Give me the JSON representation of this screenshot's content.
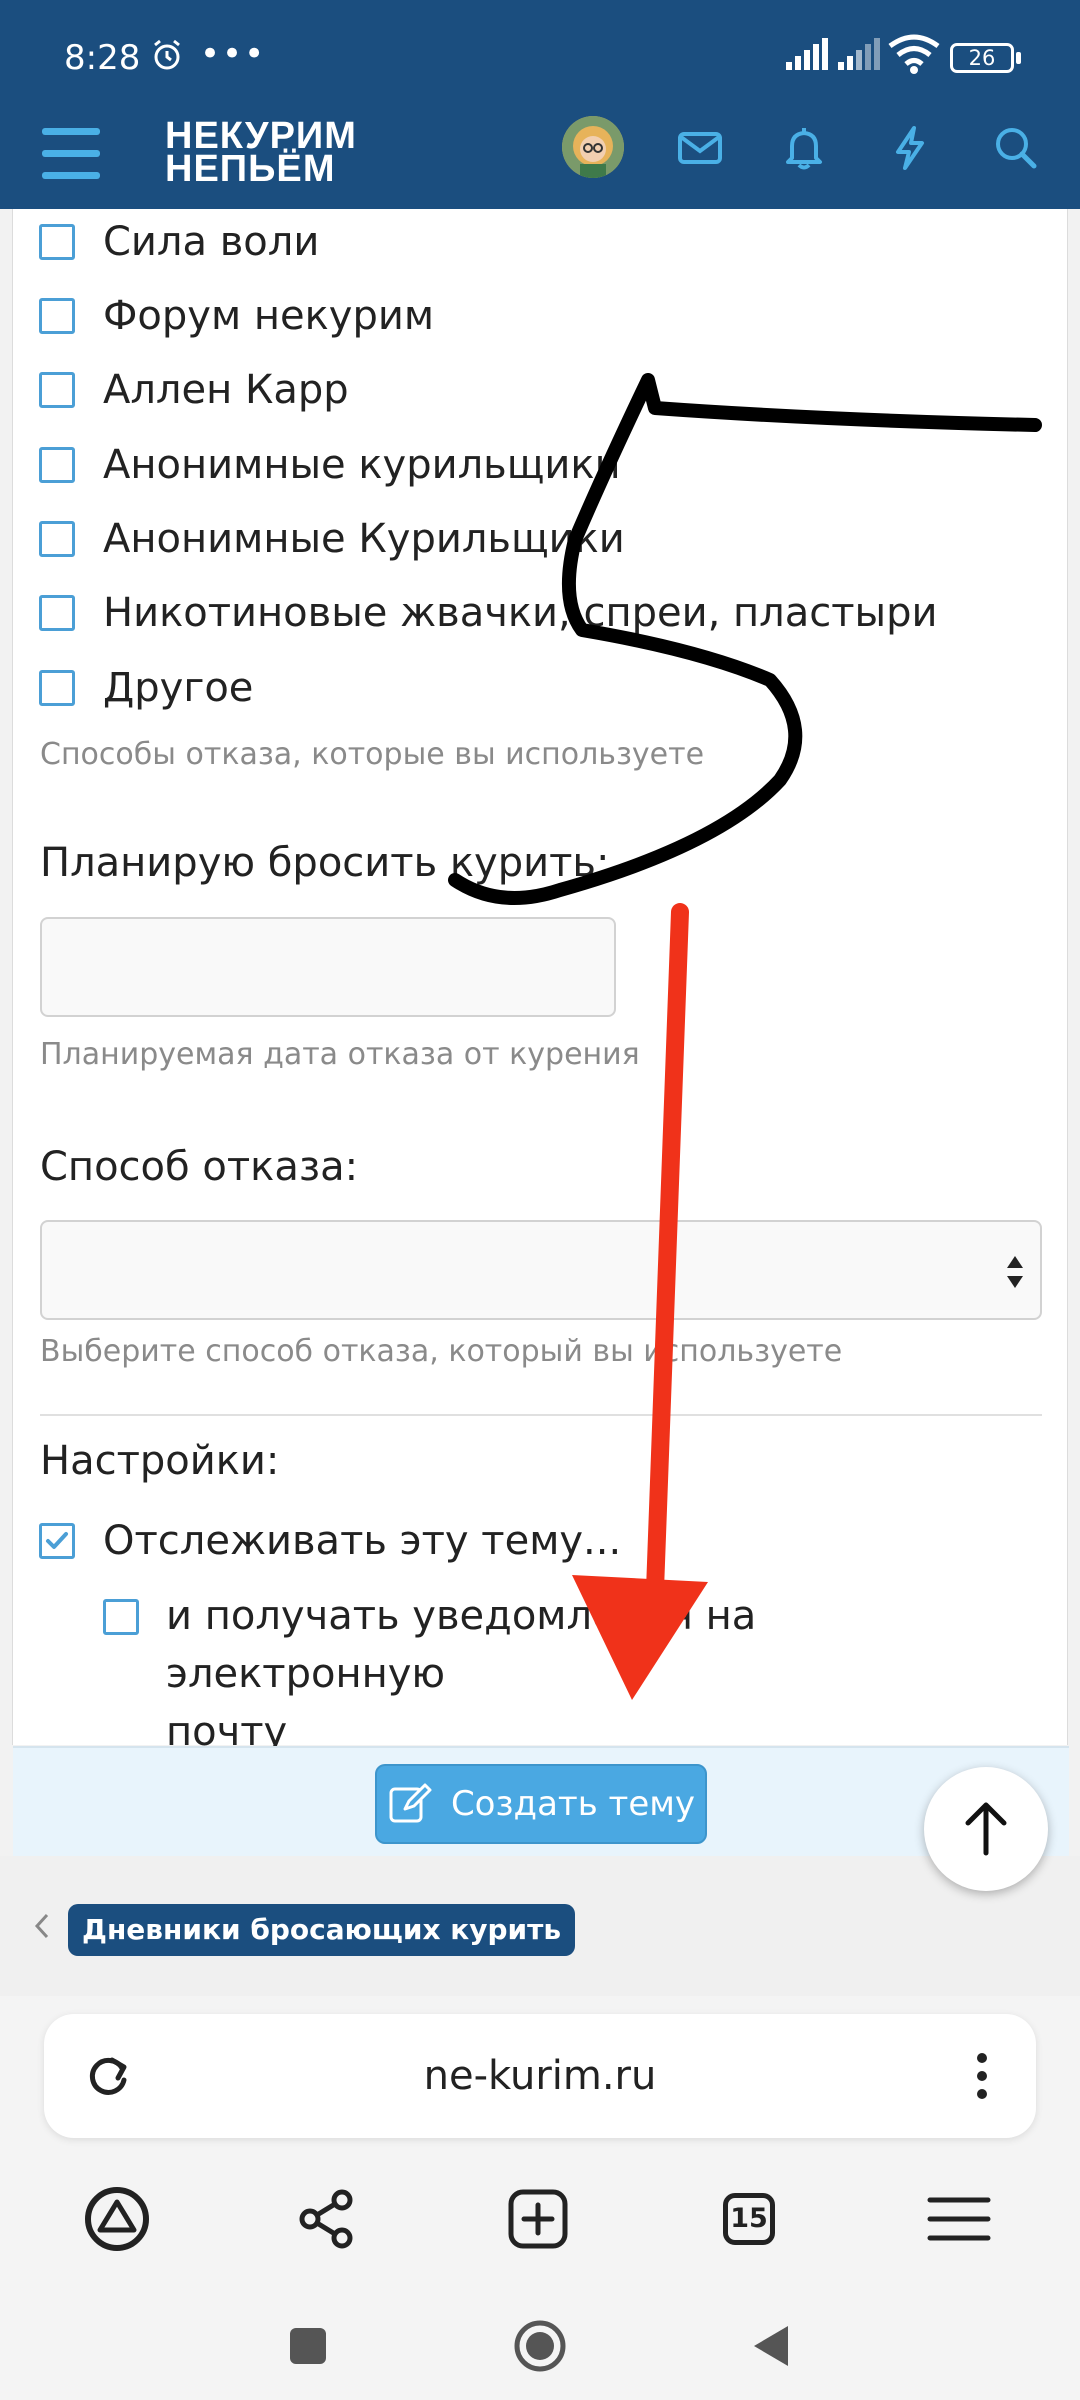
{
  "status": {
    "time": "8:28",
    "dots": "•••",
    "battery": "26"
  },
  "header": {
    "logo_line1": "НЕКУРИМ",
    "logo_line2": "НЕПЬЁМ"
  },
  "form": {
    "checkboxes": [
      {
        "label": "Сила воли",
        "checked": false
      },
      {
        "label": "Форум некурим",
        "checked": false
      },
      {
        "label": "Аллен Карр",
        "checked": false
      },
      {
        "label": "Анонимные курильщики",
        "checked": false
      },
      {
        "label": "Анонимные Курильщики",
        "checked": false
      },
      {
        "label": "Никотиновые жвачки, спреи, пластыри",
        "checked": false
      },
      {
        "label": "Другое",
        "checked": false
      }
    ],
    "methods_hint": "Способы отказа, которые вы используете",
    "plan_label": "Планирую бросить курить:",
    "plan_value": "",
    "plan_hint": "Планируемая дата отказа от курения",
    "method_label": "Способ отказа:",
    "method_value": "",
    "method_hint": "Выберите способ отказа, который вы используете",
    "settings_label": "Настройки:",
    "watch_label": "Отслеживать эту тему...",
    "watch_checked": true,
    "email_label_line1": "и получать уведомления на электронную",
    "email_label_line2": "почту",
    "email_checked": false,
    "submit_label": "Создать тему"
  },
  "breadcrumb": {
    "label": "Дневники бросающих курить"
  },
  "browser": {
    "url": "ne-kurim.ru",
    "tab_count": "15"
  },
  "annotations": {
    "drawn_number": "5",
    "ink_color": "#000000",
    "arrow_color": "#f0321a"
  },
  "colors": {
    "header_bg": "#1b4e7f",
    "accent": "#4aa8e2",
    "checkbox_border": "#4b9fd6"
  }
}
